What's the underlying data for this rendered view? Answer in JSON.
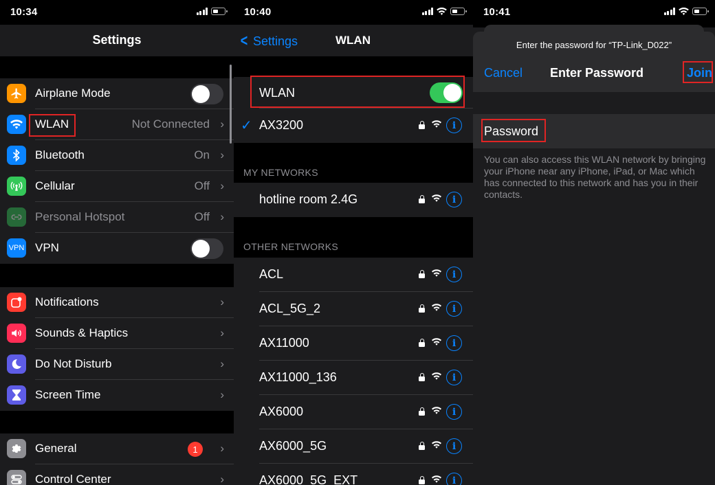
{
  "colors": {
    "accent": "#0a84ff",
    "toggle_on": "#34c759",
    "badge": "#ff3b30",
    "highlight_box": "#e02424",
    "icon_airplane": "#ff9500",
    "icon_wlan": "#0a84ff",
    "icon_bluetooth": "#0a84ff",
    "icon_cellular": "#34c759",
    "icon_hotspot": "#34c759",
    "icon_vpn": "#0a84ff",
    "icon_notifications": "#ff3b30",
    "icon_sounds": "#ff2d55",
    "icon_dnd": "#5e5ce6",
    "icon_screentime": "#5e5ce6",
    "icon_general": "#8e8e93",
    "icon_control": "#8e8e93"
  },
  "settings_screen": {
    "time": "10:34",
    "title": "Settings",
    "rows": [
      {
        "label": "Airplane Mode",
        "icon": "airplane-icon",
        "toggle": false
      },
      {
        "label": "WLAN",
        "icon": "wifi-icon",
        "value": "Not Connected"
      },
      {
        "label": "Bluetooth",
        "icon": "bluetooth-icon",
        "value": "On"
      },
      {
        "label": "Cellular",
        "icon": "cellular-icon",
        "value": "Off"
      },
      {
        "label": "Personal Hotspot",
        "icon": "hotspot-icon",
        "value": "Off",
        "disabled": true
      },
      {
        "label": "VPN",
        "icon": "vpn-icon",
        "icon_text": "VPN",
        "toggle": false
      }
    ],
    "rows2": [
      {
        "label": "Notifications",
        "icon": "notifications-icon"
      },
      {
        "label": "Sounds & Haptics",
        "icon": "speaker-icon"
      },
      {
        "label": "Do Not Disturb",
        "icon": "moon-icon"
      },
      {
        "label": "Screen Time",
        "icon": "hourglass-icon"
      }
    ],
    "rows3": [
      {
        "label": "General",
        "icon": "gear-icon",
        "badge": "1"
      },
      {
        "label": "Control Center",
        "icon": "switches-icon"
      }
    ]
  },
  "wlan_screen": {
    "time": "10:40",
    "back_label": "Settings",
    "title": "WLAN",
    "toggle_label": "WLAN",
    "toggle_on": true,
    "connected": "AX3200",
    "my_networks_header": "MY NETWORKS",
    "my_networks": [
      "hotline room 2.4G"
    ],
    "other_networks_header": "OTHER NETWORKS",
    "other_networks": [
      "ACL",
      "ACL_5G_2",
      "AX11000",
      "AX11000_136",
      "AX6000",
      "AX6000_5G",
      "AX6000_5G_EXT"
    ]
  },
  "password_screen": {
    "time": "10:41",
    "prompt": "Enter the password for “TP-Link_D022”",
    "cancel_label": "Cancel",
    "title": "Enter Password",
    "join_label": "Join",
    "password_label": "Password",
    "note": "You can also access this WLAN network by bringing your iPhone near any iPhone, iPad, or Mac which has connected to this network and has you in their contacts."
  }
}
